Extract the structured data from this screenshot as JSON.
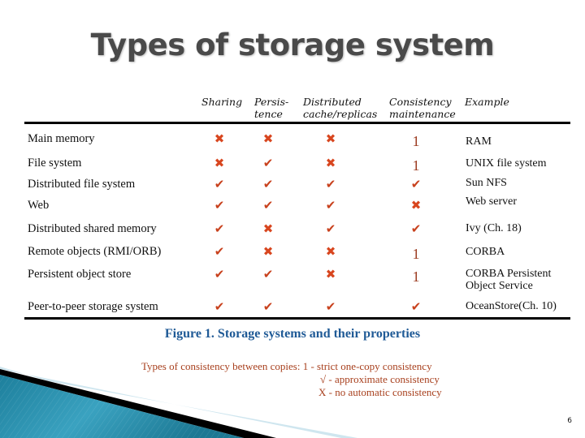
{
  "slide": {
    "title": "Types of storage system",
    "page_number": "6"
  },
  "table": {
    "columns": [
      {
        "key": "sharing",
        "label": "Sharing"
      },
      {
        "key": "persistence",
        "label": "Persis-\ntence"
      },
      {
        "key": "distributed",
        "label": "Distributed\ncache/replicas"
      },
      {
        "key": "consistency",
        "label": "Consistency\nmaintenance"
      },
      {
        "key": "example",
        "label": "Example"
      }
    ],
    "rows": [
      {
        "name": "Main memory",
        "sharing": "x",
        "persistence": "x",
        "distributed": "x",
        "consistency": "1",
        "example": "RAM"
      },
      {
        "name": "File system",
        "sharing": "x",
        "persistence": "check",
        "distributed": "x",
        "consistency": "1",
        "example": "UNIX file system"
      },
      {
        "name": "Distributed file system",
        "sharing": "check",
        "persistence": "check",
        "distributed": "check",
        "consistency": "check",
        "example": "Sun NFS"
      },
      {
        "name": "Web",
        "sharing": "check",
        "persistence": "check",
        "distributed": "check",
        "consistency": "x",
        "example": "Web server"
      },
      {
        "name": "Distributed shared memory",
        "sharing": "check",
        "persistence": "x",
        "distributed": "check",
        "consistency": "check",
        "example": "Ivy (Ch. 18)"
      },
      {
        "name": "Remote objects (RMI/ORB)",
        "sharing": "check",
        "persistence": "x",
        "distributed": "x",
        "consistency": "1",
        "example": "CORBA"
      },
      {
        "name": "Persistent object store",
        "sharing": "check",
        "persistence": "check",
        "distributed": "x",
        "consistency": "1",
        "example": "CORBA Persistent\nObject Service"
      },
      {
        "name": "Peer-to-peer storage system",
        "sharing": "check",
        "persistence": "check",
        "distributed": "check",
        "consistency": "check",
        "example": "OceanStore(Ch. 10)"
      }
    ],
    "symbols": {
      "x": "✖",
      "check": "✔",
      "1": "1"
    }
  },
  "caption": "Figure 1. Storage systems and their properties",
  "legend": {
    "heading": "Types of consistency between copies: 1 - strict one-copy consistency",
    "line2": "√ - approximate consistency",
    "line3": "X - no automatic consistency"
  },
  "colors": {
    "title": "#4a4a4a",
    "mark": "#d8461f",
    "caption": "#1f5a96",
    "legend": "#a8401e",
    "swoosh_teal": "#2a8aa8"
  }
}
